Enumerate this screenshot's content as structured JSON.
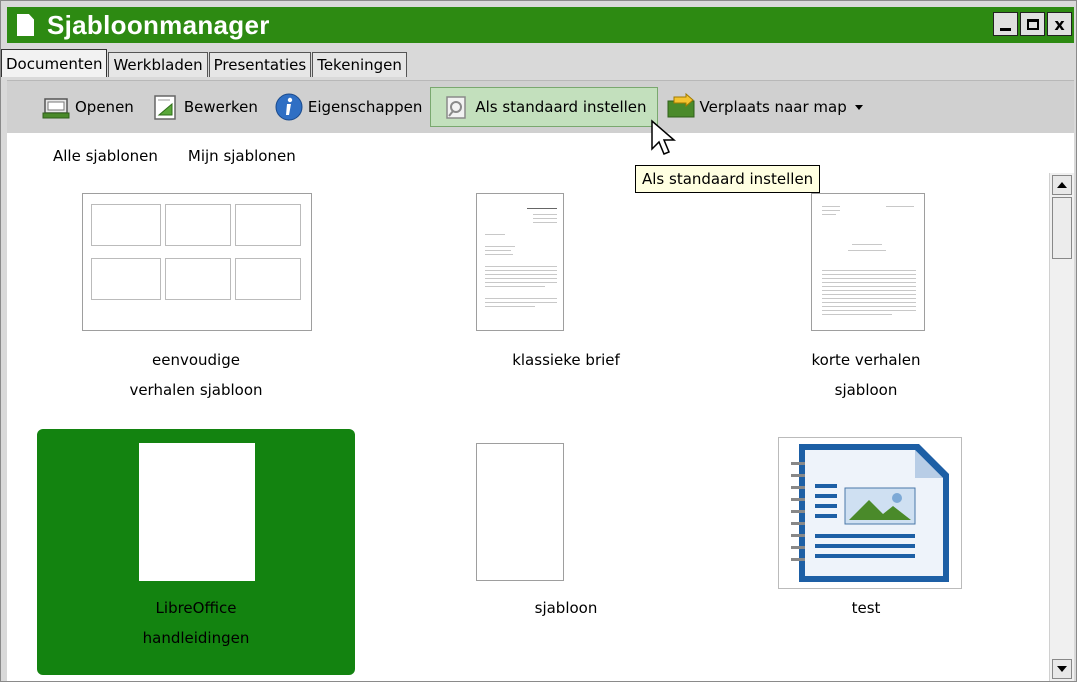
{
  "window": {
    "title": "Sjabloonmanager",
    "controls": [
      "minimize",
      "maximize",
      "close"
    ],
    "close_label": "x"
  },
  "tabs": [
    {
      "label": "Documenten",
      "active": true
    },
    {
      "label": "Werkbladen",
      "active": false
    },
    {
      "label": "Presentaties",
      "active": false
    },
    {
      "label": "Tekeningen",
      "active": false
    }
  ],
  "toolbar": {
    "open_label": "Openen",
    "edit_label": "Bewerken",
    "properties_label": "Eigenschappen",
    "set_default_label": "Als standaard instellen",
    "move_label": "Verplaats naar map"
  },
  "filters": {
    "all": "Alle sjablonen",
    "mine": "Mijn sjablonen"
  },
  "tooltip": "Als standaard instellen",
  "templates": [
    {
      "line1": "eenvoudige",
      "line2": "verhalen sjabloon",
      "selected": false
    },
    {
      "line1": "klassieke brief",
      "line2": "",
      "selected": false
    },
    {
      "line1": "korte verhalen",
      "line2": "sjabloon",
      "selected": false
    },
    {
      "line1": "LibreOffice",
      "line2": "handleidingen",
      "selected": true
    },
    {
      "line1": "sjabloon",
      "line2": "",
      "selected": false
    },
    {
      "line1": "test",
      "line2": "",
      "selected": false
    }
  ],
  "colors": {
    "titlebar": "#2d8a12",
    "selection": "#138310",
    "highlight": "#c3e0bd",
    "tooltip_bg": "#ffffe1"
  }
}
